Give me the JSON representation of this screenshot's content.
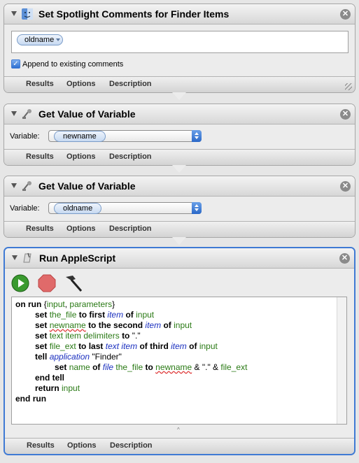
{
  "tabs": {
    "results": "Results",
    "options": "Options",
    "description": "Description"
  },
  "close_glyph": "✕",
  "actions": [
    {
      "title": "Set Spotlight Comments for Finder Items",
      "icon": "finder-icon",
      "token": "oldname",
      "checkbox_label": "Append to existing comments",
      "checked": true
    },
    {
      "title": "Get Value of Variable",
      "icon": "variable-icon",
      "variable_label": "Variable:",
      "variable_value": "newname"
    },
    {
      "title": "Get Value of Variable",
      "icon": "variable-icon",
      "variable_label": "Variable:",
      "variable_value": "oldname"
    },
    {
      "title": "Run AppleScript",
      "icon": "script-icon",
      "toolbar": [
        "run-icon",
        "stop-icon",
        "compile-icon"
      ],
      "code": {
        "l1": [
          "on",
          "run",
          "{",
          "input",
          ", ",
          "parameters",
          "}"
        ],
        "l2": [
          "set",
          "the_file",
          "to first",
          "item",
          "of",
          "input"
        ],
        "l3": [
          "set",
          "newname",
          "to the second",
          "item",
          "of",
          "input"
        ],
        "l4": [
          "set",
          "text item delimiters",
          "to",
          "\".\""
        ],
        "l5": [
          "set",
          "file_ext",
          "to last",
          "text item",
          "of third",
          "item",
          "of",
          "input"
        ],
        "l6": [
          "tell",
          "application",
          "\"Finder\""
        ],
        "l7": [
          "set",
          "name",
          "of",
          "file",
          "the_file",
          "to",
          "newname",
          "& \".\" &",
          "file_ext"
        ],
        "l8": [
          "end tell"
        ],
        "l9": [
          "return",
          "input"
        ],
        "l10": [
          "end",
          "run"
        ]
      }
    }
  ]
}
